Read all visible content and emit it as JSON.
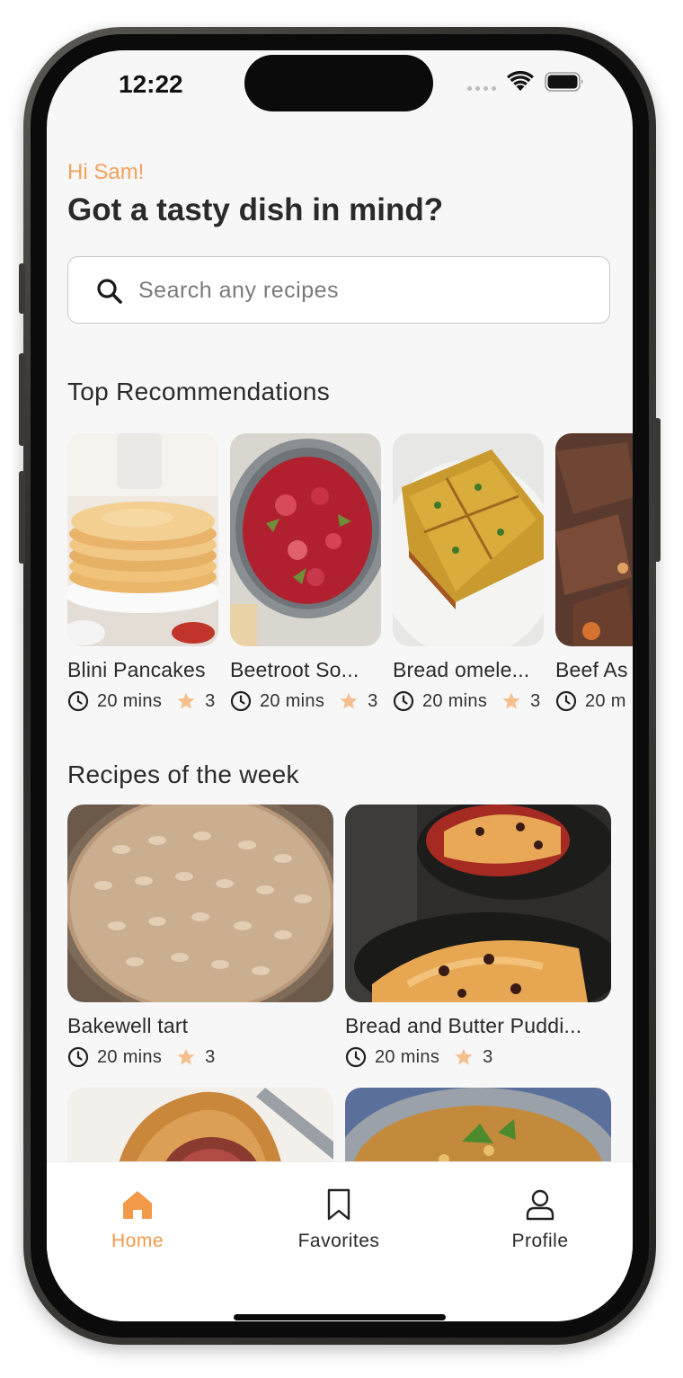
{
  "status_bar": {
    "time": "12:22"
  },
  "header": {
    "greeting": "Hi Sam!",
    "headline": "Got a tasty dish in mind?"
  },
  "search": {
    "placeholder": "Search any recipes"
  },
  "top_recommendations": {
    "title": "Top Recommendations",
    "items": [
      {
        "title": "Blini Pancakes",
        "time": "20 mins",
        "rating": "3"
      },
      {
        "title": "Beetroot So...",
        "time": "20 mins",
        "rating": "3"
      },
      {
        "title": "Bread omele...",
        "time": "20 mins",
        "rating": "3"
      },
      {
        "title": "Beef As",
        "time": "20 m",
        "rating": ""
      }
    ]
  },
  "recipes_of_week": {
    "title": "Recipes of the week",
    "items": [
      {
        "title": "Bakewell tart",
        "time": "20 mins",
        "rating": "3"
      },
      {
        "title": "Bread and Butter Puddi...",
        "time": "20 mins",
        "rating": "3"
      }
    ]
  },
  "bottom_nav": {
    "items": [
      {
        "label": "Home",
        "icon": "home-icon",
        "active": true
      },
      {
        "label": "Favorites",
        "icon": "bookmark-icon",
        "active": false
      },
      {
        "label": "Profile",
        "icon": "user-icon",
        "active": false
      }
    ]
  },
  "colors": {
    "accent": "#f3994a",
    "star": "#f6c08e",
    "text": "#2a2a2a",
    "background": "#f7f7f7"
  }
}
